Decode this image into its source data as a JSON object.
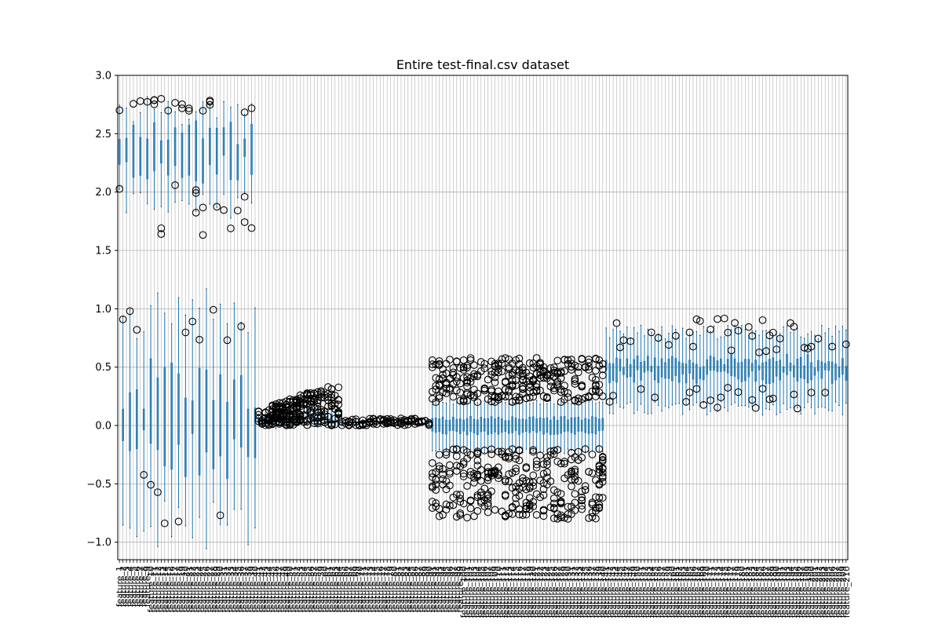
{
  "chart_data": {
    "type": "box",
    "title": "Entire test-final.csv dataset",
    "xlabel": "",
    "ylabel": "",
    "ylim": [
      -1.15,
      3.0
    ],
    "yticks": [
      -1.0,
      -0.5,
      0.0,
      0.5,
      1.0,
      1.5,
      2.0,
      2.5,
      3.0
    ],
    "ytick_labels": [
      "−1.0",
      "−0.5",
      "0.0",
      "0.5",
      "1.0",
      "1.5",
      "2.0",
      "2.5",
      "3.0"
    ],
    "grid": true,
    "category_count": 210,
    "category_prefix": "feature_",
    "box_color": "#1f77b4",
    "median_color": "#2ca02c",
    "groups": [
      {
        "range": [
          1,
          40
        ],
        "pattern": "split-upper",
        "median": 2.35,
        "q1": 2.2,
        "q3": 2.5,
        "whisker_low": 1.9,
        "whisker_high": 2.7,
        "outlier_range": [
          1.63,
          2.8
        ]
      },
      {
        "range": [
          1,
          40
        ],
        "pattern": "split-lower",
        "median": 0.05,
        "q1": -0.25,
        "q3": 0.35,
        "whisker_low": -0.85,
        "whisker_high": 0.95,
        "outlier_range": [
          -0.92,
          1.02
        ]
      },
      {
        "range": [
          41,
          64
        ],
        "pattern": "small-positive",
        "median": 0.04,
        "q1": 0.02,
        "q3": 0.07,
        "whisker_low": 0.0,
        "whisker_high": 0.12,
        "outlier_range": [
          0.0,
          0.37
        ]
      },
      {
        "range": [
          65,
          90
        ],
        "pattern": "near-zero",
        "median": 0.02,
        "q1": 0.01,
        "q3": 0.03,
        "whisker_low": 0.0,
        "whisker_high": 0.05,
        "outlier_range": [
          0.0,
          0.06
        ]
      },
      {
        "range": [
          91,
          140
        ],
        "pattern": "centered",
        "median": 0.0,
        "q1": -0.06,
        "q3": 0.06,
        "whisker_low": -0.22,
        "whisker_high": 0.2,
        "outlier_range": [
          -0.82,
          0.58
        ]
      },
      {
        "range": [
          141,
          210
        ],
        "pattern": "positive",
        "median": 0.48,
        "q1": 0.42,
        "q3": 0.55,
        "whisker_low": 0.15,
        "whisker_high": 0.8,
        "outlier_range": [
          0.13,
          0.93
        ]
      }
    ]
  }
}
